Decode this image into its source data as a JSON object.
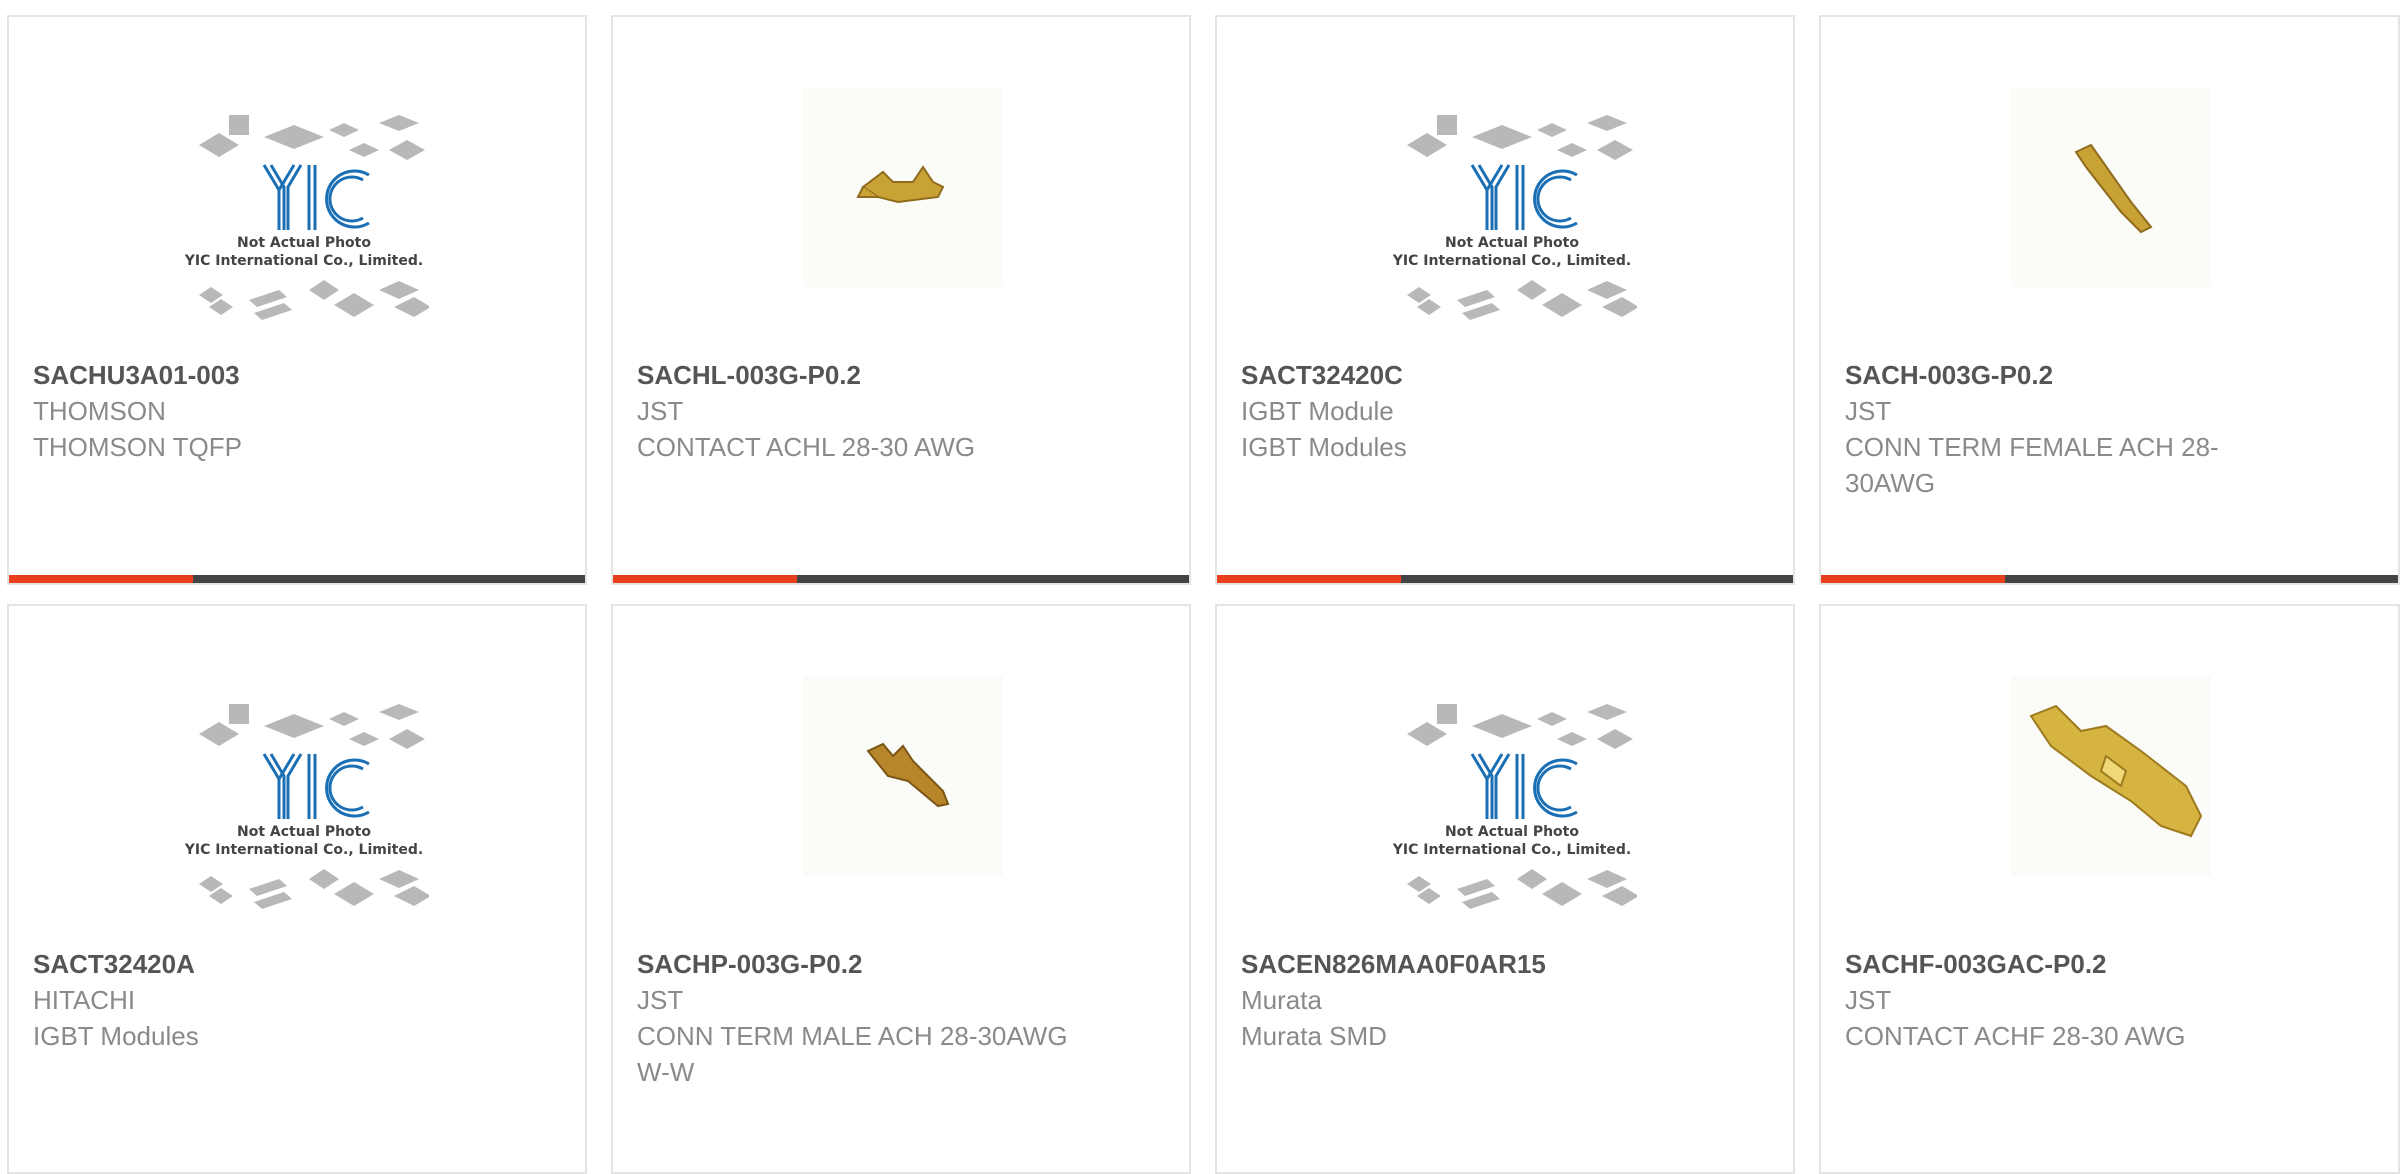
{
  "products": [
    {
      "part_number": "SACHU3A01-003",
      "manufacturer": "THOMSON",
      "description": "THOMSON TQFP",
      "image": "yic-placeholder",
      "placeholder_text": {
        "logo": "YIC",
        "line1": "Not Actual Photo",
        "line2": "YIC International Co., Limited."
      }
    },
    {
      "part_number": "SACHL-003G-P0.2",
      "manufacturer": "JST",
      "description": "CONTACT ACHL 28-30 AWG",
      "image": "contact-photo"
    },
    {
      "part_number": "SACT32420C",
      "manufacturer": "IGBT Module",
      "description": "IGBT Modules",
      "image": "yic-placeholder",
      "placeholder_text": {
        "logo": "YIC",
        "line1": "Not Actual Photo",
        "line2": "YIC International Co., Limited."
      }
    },
    {
      "part_number": "SACH-003G-P0.2",
      "manufacturer": "JST",
      "description": "CONN TERM FEMALE ACH 28-30AWG",
      "image": "contact-photo"
    },
    {
      "part_number": "SACT32420A",
      "manufacturer": "HITACHI",
      "description": "IGBT Modules",
      "image": "yic-placeholder",
      "placeholder_text": {
        "logo": "YIC",
        "line1": "Not Actual Photo",
        "line2": "YIC International Co., Limited."
      }
    },
    {
      "part_number": "SACHP-003G-P0.2",
      "manufacturer": "JST",
      "description": "CONN TERM MALE ACH 28-30AWG W-W",
      "image": "contact-photo"
    },
    {
      "part_number": "SACEN826MAA0F0AR15",
      "manufacturer": "Murata",
      "description": "Murata SMD",
      "image": "yic-placeholder",
      "placeholder_text": {
        "logo": "YIC",
        "line1": "Not Actual Photo",
        "line2": "YIC International Co., Limited."
      }
    },
    {
      "part_number": "SACHF-003GAC-P0.2",
      "manufacturer": "JST",
      "description": "CONTACT ACHF 28-30 AWG",
      "image": "contact-photo"
    }
  ],
  "colors": {
    "accent": "#e8401c",
    "bar": "#444444",
    "logo_blue": "#1a6fb5",
    "gold": "#c9a236"
  }
}
